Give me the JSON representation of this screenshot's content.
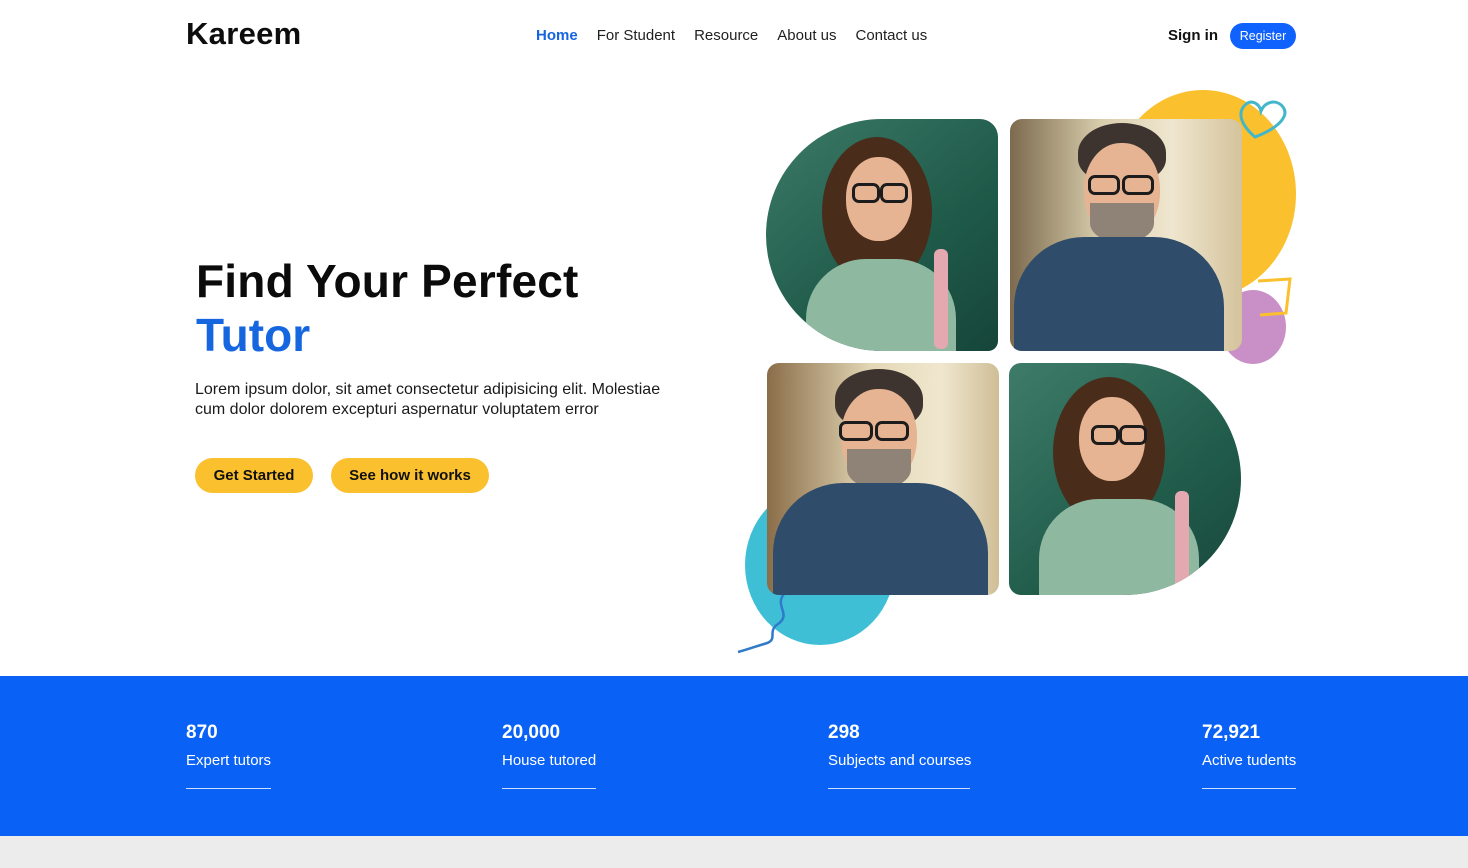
{
  "brand": {
    "name": "Kareem"
  },
  "nav": {
    "items": [
      {
        "label": "Home",
        "active": true
      },
      {
        "label": "For Student",
        "active": false
      },
      {
        "label": "Resource",
        "active": false
      },
      {
        "label": "About us",
        "active": false
      },
      {
        "label": "Contact us",
        "active": false
      }
    ],
    "sign_in": "Sign in",
    "register": "Register"
  },
  "hero": {
    "title_line1": "Find Your Perfect",
    "title_line2": "Tutor",
    "description": "Lorem ipsum dolor, sit amet consectetur adipisicing elit. Molestiae cum dolor dolorem excepturi aspernatur voluptatem error",
    "primary_button": "Get Started",
    "secondary_button": "See how it works"
  },
  "stats": [
    {
      "value": "870",
      "label": "Expert tutors"
    },
    {
      "value": "20,000",
      "label": "House tutored"
    },
    {
      "value": "298",
      "label": "Subjects and courses"
    },
    {
      "value": "72,921",
      "label": "Active tudents"
    }
  ],
  "colors": {
    "accent_blue": "#0961f5",
    "link_blue": "#1666e0",
    "button_yellow": "#fbc02d",
    "decor_pink": "#c990c8",
    "decor_teal": "#3fbfd6"
  }
}
